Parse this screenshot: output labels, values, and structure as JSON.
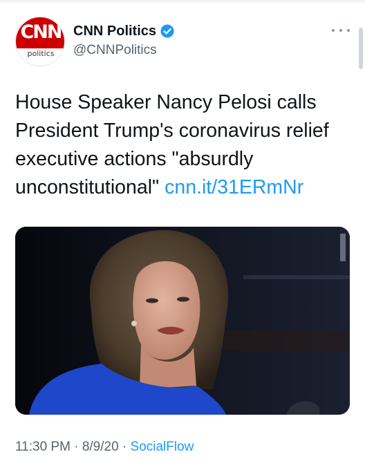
{
  "account": {
    "avatar_logo": "CNN",
    "avatar_sub": "politics",
    "display_name": "CNN Politics",
    "handle": "@CNNPolitics",
    "verified": true
  },
  "tweet": {
    "text": "House Speaker Nancy Pelosi calls President Trump's coronavirus relief executive actions \"absurdly unconstitutional\"",
    "link": "cnn.it/31ERmNr",
    "image_alt": "Photo of Nancy Pelosi speaking at a press conference"
  },
  "meta": {
    "time": "11:30 PM",
    "separator": "·",
    "date": "8/9/20",
    "source": "SocialFlow"
  },
  "icons": {
    "verified": "verified-badge-icon",
    "more": "more-options-icon"
  },
  "colors": {
    "brand_red": "#cc0000",
    "link_blue": "#1d9bf0",
    "secondary_text": "#536471"
  }
}
